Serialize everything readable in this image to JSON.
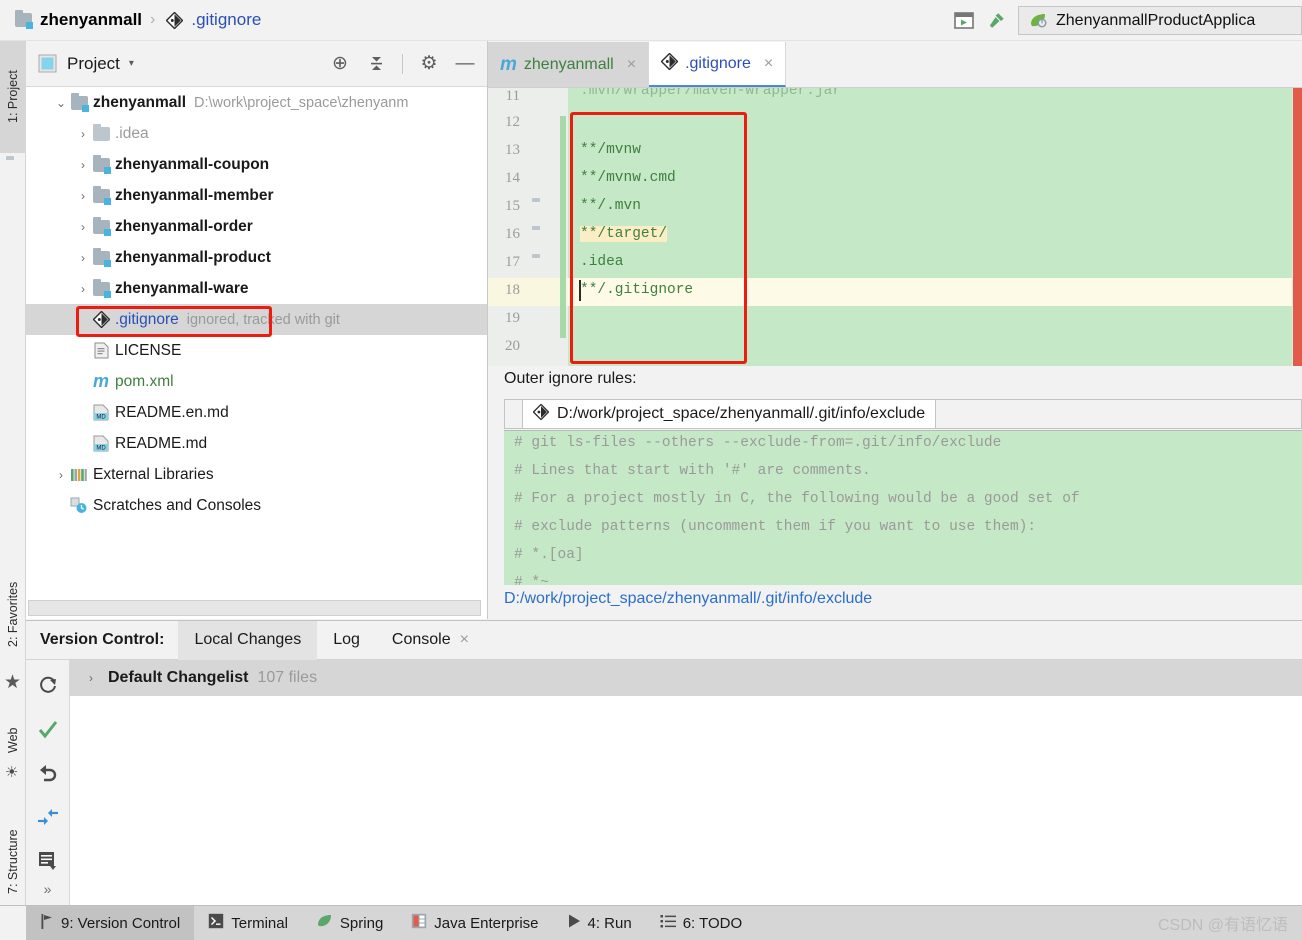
{
  "breadcrumb": {
    "project": "zhenyanmall",
    "separator": "›",
    "file": ".gitignore",
    "project_icon": "module-folder-icon",
    "file_icon": "git-file-icon"
  },
  "toolbar": {
    "run_config_name": "ZhenyanmallProductApplica",
    "run_config_icon": "spring-boot-icon",
    "buttons": [
      {
        "name": "run-dashboard-icon",
        "glyph": "▶"
      },
      {
        "name": "build-hammer-icon",
        "glyph": "⚒"
      }
    ]
  },
  "left_tool_strip": {
    "items": [
      {
        "label": "1: Project",
        "icon": "folder-icon",
        "selected": true
      },
      {
        "label": "2: Favorites",
        "icon": "star-icon",
        "selected": false
      },
      {
        "label": "Web",
        "icon": "globe-icon",
        "selected": false
      },
      {
        "label": "7: Structure",
        "icon": "structure-icon",
        "selected": false
      }
    ]
  },
  "project_panel": {
    "title": "Project",
    "dropdown_caret": "▾",
    "icons": [
      {
        "name": "locate-target-icon",
        "glyph": "⊕"
      },
      {
        "name": "collapse-all-icon",
        "glyph": "⩥"
      },
      {
        "name": "settings-gear-icon",
        "glyph": "⚙"
      },
      {
        "name": "hide-panel-icon",
        "glyph": "—"
      }
    ],
    "tree": [
      {
        "depth": 0,
        "arrow": "⌄",
        "icon": "module-folder-icon",
        "label": "zhenyanmall",
        "bold": true,
        "suffix": "D:\\work\\project_space\\zhenyanm",
        "selected": false,
        "color": "default"
      },
      {
        "depth": 1,
        "arrow": "›",
        "icon": "folder-icon",
        "label": ".idea",
        "bold": false,
        "suffix": "",
        "selected": false,
        "color": "grey"
      },
      {
        "depth": 1,
        "arrow": "›",
        "icon": "module-folder-icon",
        "label": "zhenyanmall-coupon",
        "bold": true,
        "suffix": "",
        "selected": false,
        "color": "default"
      },
      {
        "depth": 1,
        "arrow": "›",
        "icon": "module-folder-icon",
        "label": "zhenyanmall-member",
        "bold": true,
        "suffix": "",
        "selected": false,
        "color": "default"
      },
      {
        "depth": 1,
        "arrow": "›",
        "icon": "module-folder-icon",
        "label": "zhenyanmall-order",
        "bold": true,
        "suffix": "",
        "selected": false,
        "color": "default"
      },
      {
        "depth": 1,
        "arrow": "›",
        "icon": "module-folder-icon",
        "label": "zhenyanmall-product",
        "bold": true,
        "suffix": "",
        "selected": false,
        "color": "default"
      },
      {
        "depth": 1,
        "arrow": "›",
        "icon": "module-folder-icon",
        "label": "zhenyanmall-ware",
        "bold": true,
        "suffix": "",
        "selected": false,
        "color": "default"
      },
      {
        "depth": 2,
        "arrow": "",
        "icon": "git-file-icon",
        "label": ".gitignore",
        "bold": false,
        "suffix": "ignored, tracked with git",
        "selected": true,
        "color": "blue"
      },
      {
        "depth": 2,
        "arrow": "",
        "icon": "text-file-icon",
        "label": "LICENSE",
        "bold": false,
        "suffix": "",
        "selected": false,
        "color": "default"
      },
      {
        "depth": 2,
        "arrow": "",
        "icon": "maven-pom-icon",
        "label": "pom.xml",
        "bold": false,
        "suffix": "",
        "selected": false,
        "color": "green"
      },
      {
        "depth": 2,
        "arrow": "",
        "icon": "markdown-file-icon",
        "label": "README.en.md",
        "bold": false,
        "suffix": "",
        "selected": false,
        "color": "default"
      },
      {
        "depth": 2,
        "arrow": "",
        "icon": "markdown-file-icon",
        "label": "README.md",
        "bold": false,
        "suffix": "",
        "selected": false,
        "color": "default"
      },
      {
        "depth": 0,
        "arrow": "›",
        "icon": "external-libraries-icon",
        "label": "External Libraries",
        "bold": false,
        "suffix": "",
        "selected": false,
        "color": "default"
      },
      {
        "depth": 0,
        "arrow": "",
        "icon": "scratches-icon",
        "label": "Scratches and Consoles",
        "bold": false,
        "suffix": "",
        "selected": false,
        "color": "default"
      }
    ]
  },
  "editor": {
    "tabs": [
      {
        "label": "zhenyanmall",
        "icon": "maven-pom-icon",
        "active": false,
        "close": "×"
      },
      {
        "label": ".gitignore",
        "icon": "git-file-icon",
        "active": true,
        "close": "×"
      }
    ],
    "lines": [
      {
        "number": "11",
        "text": ".mvn/wrapper/maven-wrapper.jar",
        "folder_marker": false,
        "caret": false,
        "clipped": true
      },
      {
        "number": "12",
        "text": "",
        "folder_marker": false,
        "caret": false,
        "clipped": false
      },
      {
        "number": "13",
        "text": "**/mvnw",
        "folder_marker": false,
        "caret": false,
        "clipped": false
      },
      {
        "number": "14",
        "text": "**/mvnw.cmd",
        "folder_marker": false,
        "caret": false,
        "clipped": false
      },
      {
        "number": "15",
        "text": "**/.mvn",
        "folder_marker": true,
        "caret": false,
        "clipped": false
      },
      {
        "number": "16",
        "text": "**/target/",
        "folder_marker": true,
        "caret": false,
        "clipped": false,
        "highlight": true
      },
      {
        "number": "17",
        "text": ".idea",
        "folder_marker": true,
        "caret": false,
        "clipped": false
      },
      {
        "number": "18",
        "text": "**/.gitignore",
        "folder_marker": false,
        "caret": true,
        "clipped": false
      },
      {
        "number": "19",
        "text": "",
        "folder_marker": false,
        "caret": false,
        "clipped": false
      },
      {
        "number": "20",
        "text": "",
        "folder_marker": false,
        "caret": false,
        "clipped": false
      }
    ]
  },
  "outer_ignore": {
    "label": "Outer ignore rules:",
    "path_tab": "D:/work/project_space/zhenyanmall/.git/info/exclude",
    "path_tab_icon": "git-file-icon",
    "code_lines": [
      "# git ls-files --others --exclude-from=.git/info/exclude",
      "# Lines that start with '#' are comments.",
      "# For a project mostly in C, the following would be a good set of",
      "# exclude patterns (uncomment them if you want to use them):",
      "# *.[oa]",
      "# *~"
    ],
    "footer_link": "D:/work/project_space/zhenyanmall/.git/info/exclude"
  },
  "version_control": {
    "title": "Version Control:",
    "tabs": [
      {
        "label": "Local Changes",
        "selected": true,
        "closable": false
      },
      {
        "label": "Log",
        "selected": false,
        "closable": false
      },
      {
        "label": "Console",
        "selected": false,
        "closable": true,
        "close": "×"
      }
    ],
    "side_buttons": [
      {
        "name": "refresh-icon",
        "glyph": "↻"
      },
      {
        "name": "commit-checkmark-icon",
        "glyph": "✓"
      },
      {
        "name": "rollback-icon",
        "glyph": "↶"
      },
      {
        "name": "shelve-icon",
        "glyph": "⇥"
      },
      {
        "name": "changelist-icon",
        "glyph": "▤"
      }
    ],
    "more_button": "»",
    "changelist": {
      "arrow": "›",
      "name": "Default Changelist",
      "count": "107 files"
    }
  },
  "status_bar": {
    "items": [
      {
        "label": "9: Version Control",
        "icon": "vcs-branch-icon",
        "selected": true,
        "mnemonic": "9"
      },
      {
        "label": "Terminal",
        "icon": "terminal-icon",
        "selected": false,
        "mnemonic": ""
      },
      {
        "label": "Spring",
        "icon": "spring-leaf-icon",
        "selected": false,
        "mnemonic": ""
      },
      {
        "label": "Java Enterprise",
        "icon": "java-enterprise-icon",
        "selected": false,
        "mnemonic": ""
      },
      {
        "label": "4: Run",
        "icon": "run-play-icon",
        "selected": false,
        "mnemonic": "4"
      },
      {
        "label": "6: TODO",
        "icon": "todo-list-icon",
        "selected": false,
        "mnemonic": "6"
      }
    ],
    "watermark": "CSDN @有语忆语"
  },
  "colors": {
    "ignored_green": "#c5e8c6",
    "caret_row_yellow": "#fdfae8",
    "annotation_red": "#ee1b11",
    "link_blue": "#2a4fb8",
    "selection_grey": "#d6d6d6"
  }
}
